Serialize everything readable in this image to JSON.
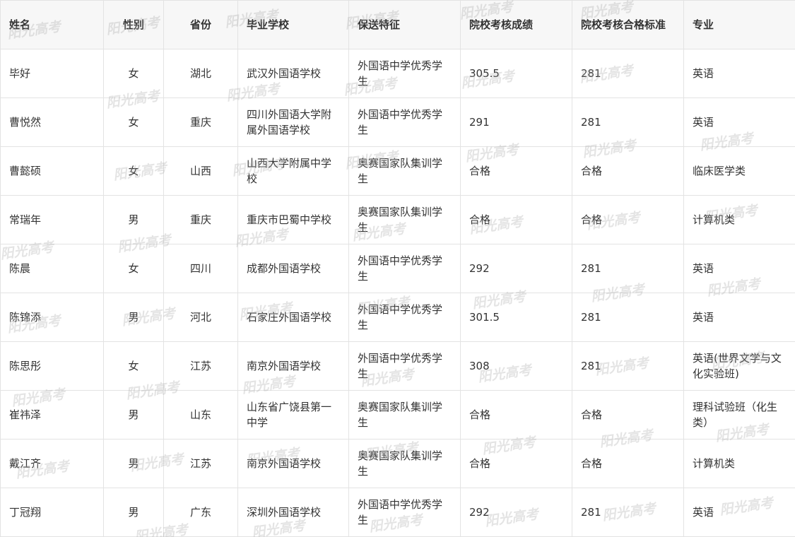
{
  "watermark_text": "阳光高考",
  "table": {
    "headers": [
      "姓名",
      "性别",
      "省份",
      "毕业学校",
      "保送特征",
      "院校考核成绩",
      "院校考核合格标准",
      "专业"
    ],
    "rows": [
      [
        "毕好",
        "女",
        "湖北",
        "武汉外国语学校",
        "外国语中学优秀学生",
        "305.5",
        "281",
        "英语"
      ],
      [
        "曹悦然",
        "女",
        "重庆",
        "四川外国语大学附属外国语学校",
        "外国语中学优秀学生",
        "291",
        "281",
        "英语"
      ],
      [
        "曹懿硕",
        "女",
        "山西",
        "山西大学附属中学校",
        "奥赛国家队集训学生",
        "合格",
        "合格",
        "临床医学类"
      ],
      [
        "常瑞年",
        "男",
        "重庆",
        "重庆市巴蜀中学校",
        "奥赛国家队集训学生",
        "合格",
        "合格",
        "计算机类"
      ],
      [
        "陈晨",
        "女",
        "四川",
        "成都外国语学校",
        "外国语中学优秀学生",
        "292",
        "281",
        "英语"
      ],
      [
        "陈锦添",
        "男",
        "河北",
        "石家庄外国语学校",
        "外国语中学优秀学生",
        "301.5",
        "281",
        "英语"
      ],
      [
        "陈思彤",
        "女",
        "江苏",
        "南京外国语学校",
        "外国语中学优秀学生",
        "308",
        "281",
        "英语(世界文学与文化实验班)"
      ],
      [
        "崔祎泽",
        "男",
        "山东",
        "山东省广饶县第一中学",
        "奥赛国家队集训学生",
        "合格",
        "合格",
        "理科试验班（化生类）"
      ],
      [
        "戴江齐",
        "男",
        "江苏",
        "南京外国语学校",
        "奥赛国家队集训学生",
        "合格",
        "合格",
        "计算机类"
      ],
      [
        "丁冠翔",
        "男",
        "广东",
        "深圳外国语学校",
        "外国语中学优秀学生",
        "292",
        "281",
        "英语"
      ]
    ]
  }
}
